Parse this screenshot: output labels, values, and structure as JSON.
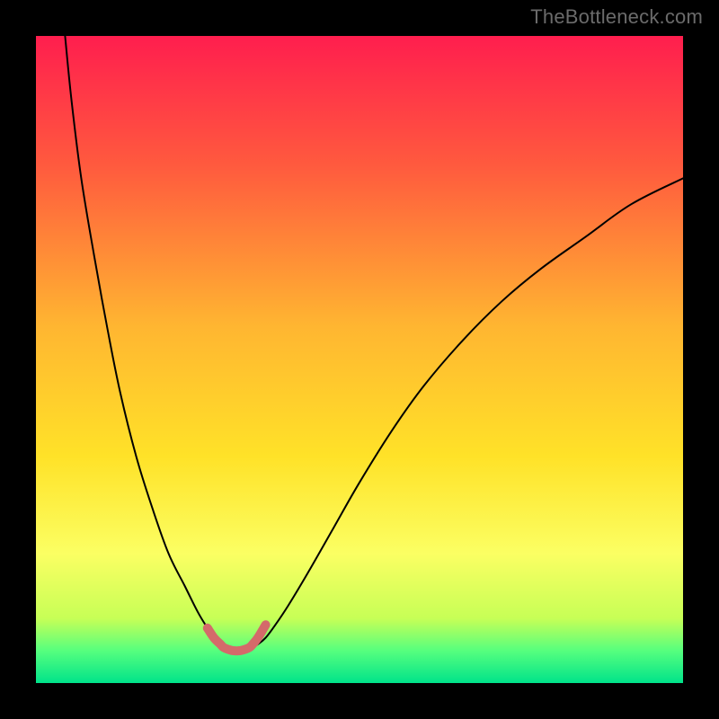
{
  "attribution": "TheBottleneck.com",
  "chart_data": {
    "type": "line",
    "title": "",
    "xlabel": "",
    "ylabel": "",
    "xlim": [
      0,
      100
    ],
    "ylim": [
      0,
      100
    ],
    "grid": false,
    "legend": false,
    "gradient_stops": [
      {
        "offset": 0.0,
        "color": "#ff1e4e"
      },
      {
        "offset": 0.2,
        "color": "#ff5a3e"
      },
      {
        "offset": 0.45,
        "color": "#ffb631"
      },
      {
        "offset": 0.65,
        "color": "#ffe228"
      },
      {
        "offset": 0.8,
        "color": "#fbff63"
      },
      {
        "offset": 0.9,
        "color": "#c7ff56"
      },
      {
        "offset": 0.95,
        "color": "#56ff7e"
      },
      {
        "offset": 1.0,
        "color": "#00e38a"
      }
    ],
    "series": [
      {
        "name": "bottleneck-curve-left",
        "color": "#000000",
        "width": 2,
        "x": [
          4.5,
          5.5,
          7,
          9,
          11,
          13,
          15.5,
          18,
          20.5,
          23,
          25,
          26.5,
          27.5,
          28.5,
          29
        ],
        "y": [
          100,
          90,
          78,
          66,
          55,
          45,
          35,
          27,
          20,
          15,
          11,
          8.5,
          7,
          6,
          5.5
        ]
      },
      {
        "name": "bottleneck-curve-right",
        "color": "#000000",
        "width": 2,
        "x": [
          33.5,
          34.3,
          35.5,
          37,
          39,
          42,
          46,
          50,
          55,
          60,
          66,
          72,
          78,
          85,
          92,
          100
        ],
        "y": [
          5.5,
          6,
          7,
          9,
          12,
          17,
          24,
          31,
          39,
          46,
          53,
          59,
          64,
          69,
          74,
          78
        ]
      },
      {
        "name": "bottleneck-floor-highlight",
        "color": "#d46a6a",
        "width": 10,
        "x": [
          26.5,
          27.5,
          28.5,
          29,
          29.7,
          30.5,
          31.5,
          32.3,
          33,
          33.5,
          34.3,
          35.5
        ],
        "y": [
          8.5,
          7,
          6,
          5.5,
          5.2,
          5.0,
          5.0,
          5.2,
          5.5,
          6,
          7,
          9
        ]
      }
    ]
  }
}
